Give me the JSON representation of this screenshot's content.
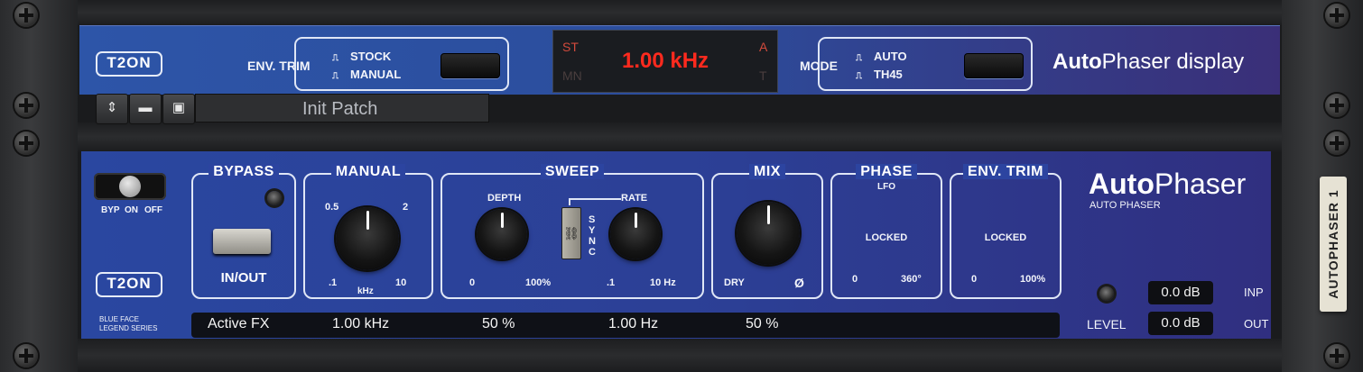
{
  "brand": "T2ON",
  "display": {
    "env_trim_label": "ENV. TRIM",
    "env_trim_options": [
      "STOCK",
      "MANUAL"
    ],
    "lcd_indicators": {
      "top_left": "ST",
      "bottom_left": "MN",
      "top_right": "A",
      "bottom_right": "T"
    },
    "lcd_value": "1.00 kHz",
    "mode_label": "MODE",
    "mode_options": [
      "AUTO",
      "TH45"
    ],
    "title_bold": "Auto",
    "title_rest": "Phaser display"
  },
  "patch": {
    "name": "Init Patch"
  },
  "panel": {
    "switch_labels": [
      "BYP",
      "ON",
      "OFF"
    ],
    "bypass": {
      "title": "BYPASS",
      "button_label": "IN/OUT"
    },
    "manual": {
      "title": "MANUAL",
      "scale": [
        "0.5",
        "2",
        ".1",
        "10"
      ],
      "unit": "kHz"
    },
    "sweep": {
      "title": "SWEEP",
      "depth_label": "DEPTH",
      "rate_label": "RATE",
      "sync_label": "SYNC",
      "depth_scale": [
        "0",
        "100%"
      ],
      "rate_scale": [
        ".1",
        "10 Hz"
      ]
    },
    "mix": {
      "title": "MIX",
      "scale": [
        "DRY",
        "Ø"
      ]
    },
    "phase": {
      "title": "PHASE",
      "subtitle": "LFO",
      "state": "LOCKED",
      "scale": [
        "0",
        "360°"
      ]
    },
    "env_trim": {
      "title": "ENV. TRIM",
      "state": "LOCKED",
      "scale": [
        "0",
        "100%"
      ]
    },
    "product_bold": "Auto",
    "product_rest": "Phaser",
    "product_sub": "AUTO PHASER",
    "series": [
      "BLUE FACE",
      "LEGEND SERIES"
    ],
    "status": {
      "label": "Active FX",
      "manual": "1.00 kHz",
      "depth": "50 %",
      "rate": "1.00 Hz",
      "mix": "50 %"
    },
    "level": {
      "label": "LEVEL",
      "input": "0.0 dB",
      "input_label": "INP",
      "output": "0.0 dB",
      "output_label": "OUT"
    }
  },
  "tape_label": "AUTOPHASER 1"
}
